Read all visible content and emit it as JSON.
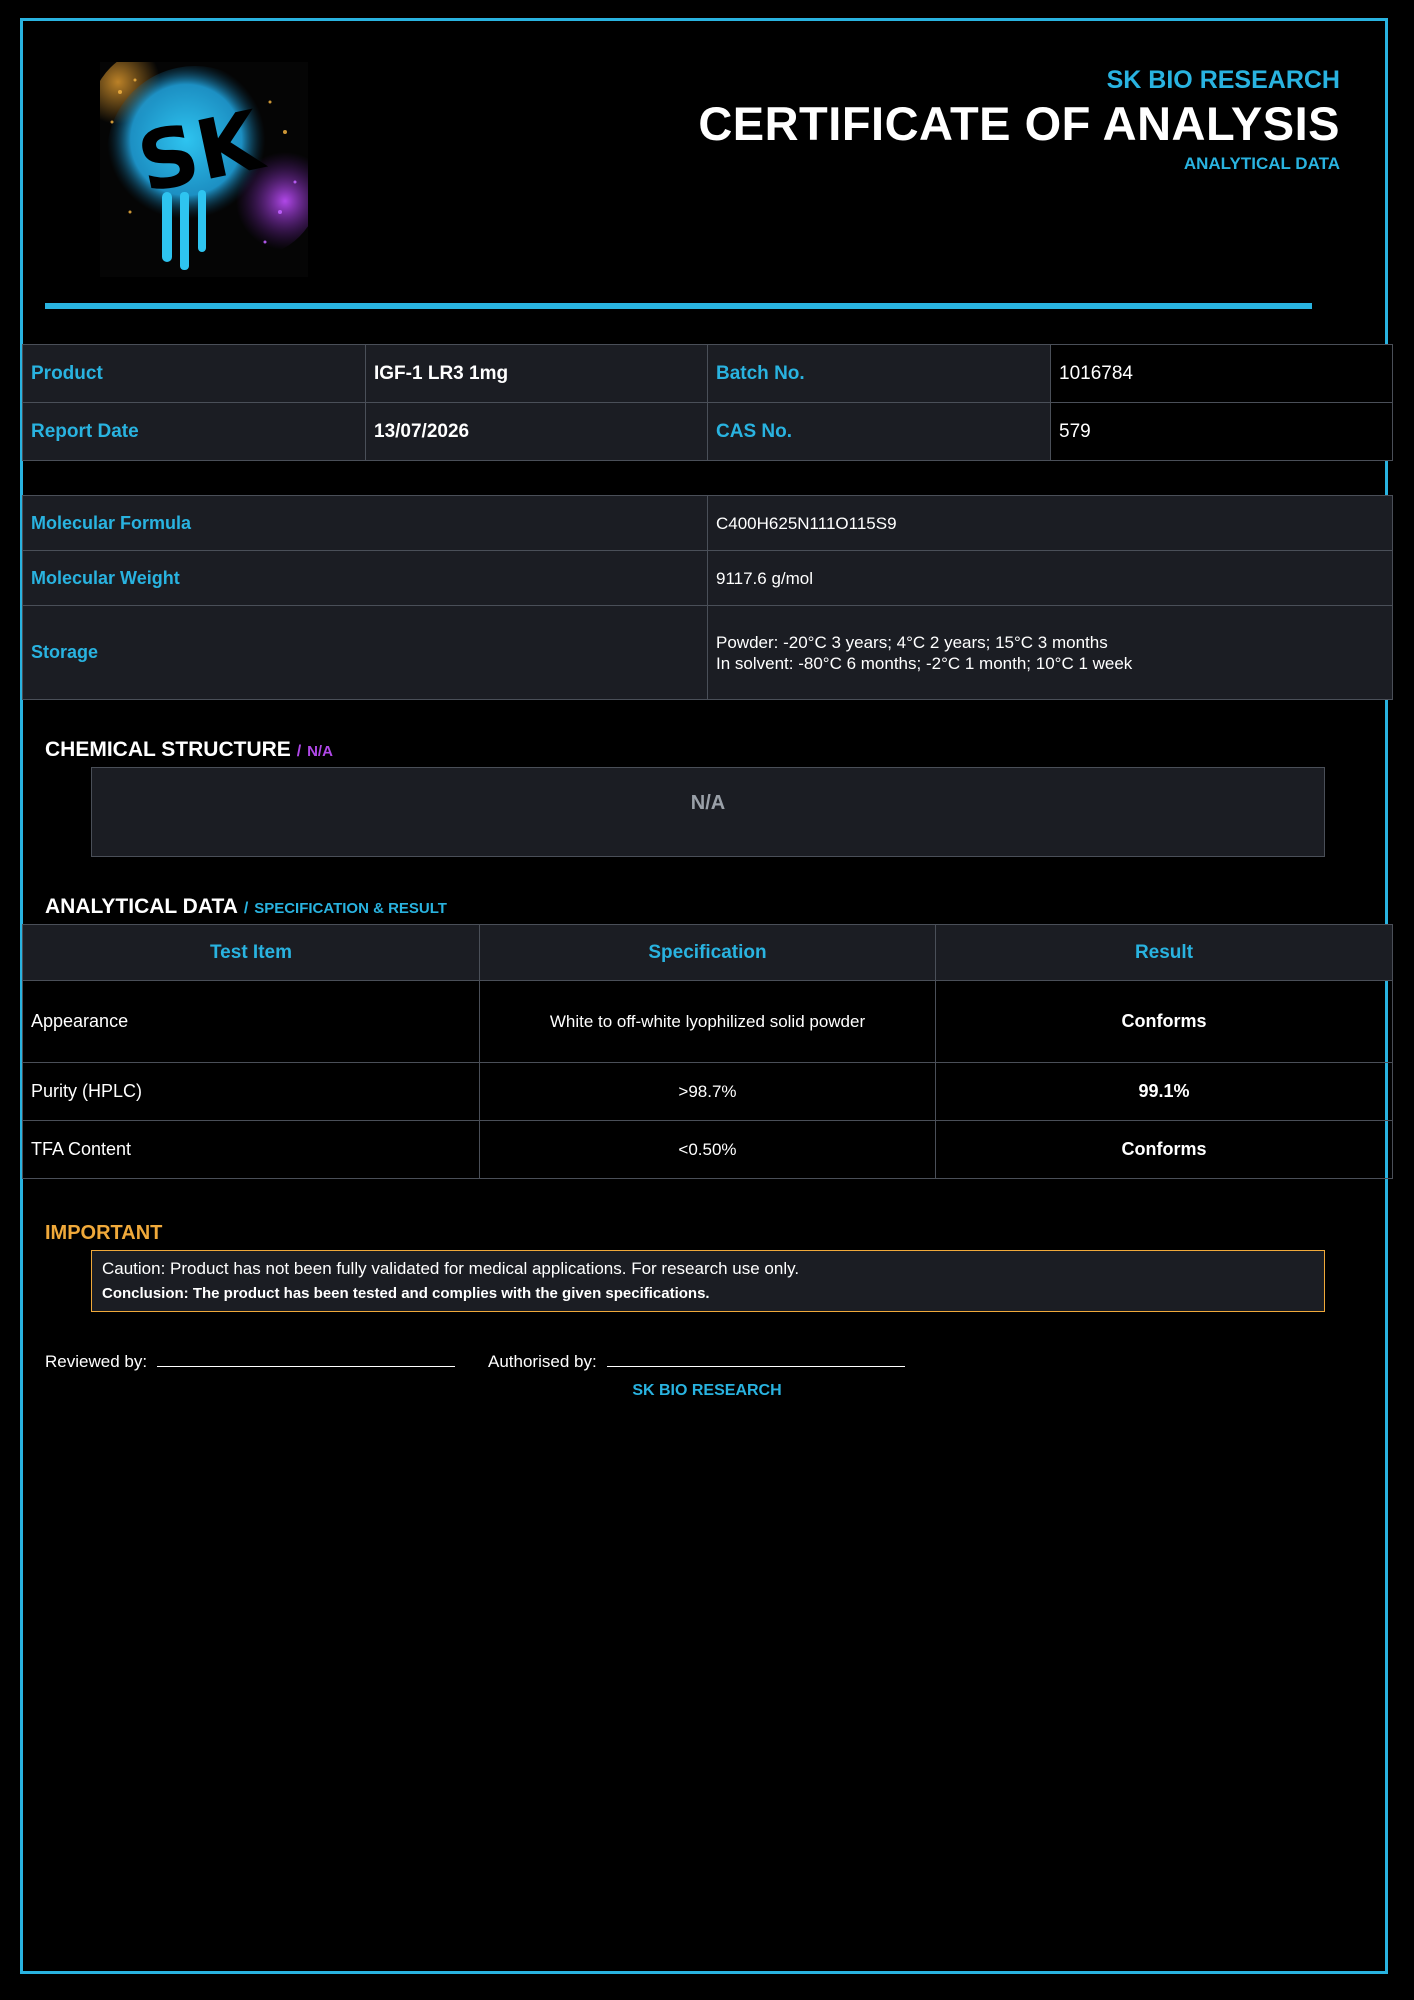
{
  "header": {
    "brand": "SK BIO RESEARCH",
    "title": "CERTIFICATE OF ANALYSIS",
    "subtitle": "ANALYTICAL DATA",
    "logo_text": "SK"
  },
  "info": {
    "product_label": "Product",
    "product_value": "IGF-1 LR3 1mg",
    "batch_label": "Batch No.",
    "batch_value": "1016784",
    "report_date_label": "Report Date",
    "report_date_value": "13/07/2026",
    "cas_label": "CAS No.",
    "cas_value": "579"
  },
  "properties": {
    "formula_label": "Molecular Formula",
    "formula_value": "C400H625N111O115S9",
    "weight_label": "Molecular Weight",
    "weight_value": "9117.6 g/mol",
    "storage_label": "Storage",
    "storage_line1": "Powder: -20°C 3 years; 4°C 2 years; 15°C 3 months",
    "storage_line2": "In solvent: -80°C 6 months; -2°C 1 month; 10°C 1 week"
  },
  "structure": {
    "heading": "CHEMICAL STRUCTURE",
    "slash": "/",
    "heading_sub": "N/A",
    "box_text": "N/A"
  },
  "analytical": {
    "heading": "ANALYTICAL DATA",
    "slash": "/",
    "heading_sub": "SPECIFICATION & RESULT",
    "columns": [
      "Test Item",
      "Specification",
      "Result"
    ],
    "rows": [
      {
        "item": "Appearance",
        "spec": "White to off-white lyophilized solid powder",
        "result": "Conforms"
      },
      {
        "item": "Purity (HPLC)",
        "spec": ">98.7%",
        "result": "99.1%"
      },
      {
        "item": "TFA Content",
        "spec": "<0.50%",
        "result": "Conforms"
      }
    ]
  },
  "important": {
    "heading": "IMPORTANT",
    "caution": "Caution: Product has not been fully validated for medical applications. For research use only.",
    "conclusion": "Conclusion: The product has been tested and complies with the given specifications."
  },
  "signatures": {
    "reviewed": "Reviewed by:",
    "authorised": "Authorised by:"
  },
  "footer": {
    "brand": "SK BIO RESEARCH"
  },
  "colors": {
    "accent": "#29b3e0",
    "warning": "#f0a93a",
    "purple": "#b048e8",
    "panel": "#1b1d23",
    "background": "#000000"
  }
}
